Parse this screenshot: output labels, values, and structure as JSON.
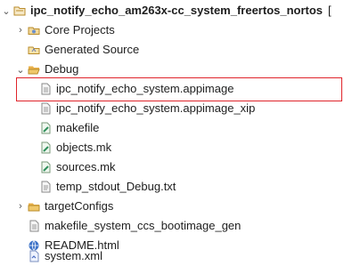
{
  "tree": {
    "project": {
      "label": "ipc_notify_echo_am263x-cc_system_freertos_nortos",
      "suffix": "[",
      "icon": "project-folder-icon",
      "expanded": true
    },
    "items": [
      {
        "label": "Core Projects",
        "icon": "core-projects-icon",
        "expandable": true,
        "expanded": false
      },
      {
        "label": "Generated Source",
        "icon": "generated-source-icon",
        "expandable": false
      },
      {
        "label": "Debug",
        "icon": "folder-open-icon",
        "expandable": true,
        "expanded": true
      },
      {
        "label": "ipc_notify_echo_system.appimage",
        "icon": "file-icon",
        "highlighted": true
      },
      {
        "label": "ipc_notify_echo_system.appimage_xip",
        "icon": "file-icon"
      },
      {
        "label": "makefile",
        "icon": "makefile-icon"
      },
      {
        "label": "objects.mk",
        "icon": "makefile-icon"
      },
      {
        "label": "sources.mk",
        "icon": "makefile-icon"
      },
      {
        "label": "temp_stdout_Debug.txt",
        "icon": "text-file-icon"
      },
      {
        "label": "targetConfigs",
        "icon": "folder-icon",
        "expandable": true,
        "expanded": false
      },
      {
        "label": "makefile_system_ccs_bootimage_gen",
        "icon": "file-icon"
      },
      {
        "label": "README.html",
        "icon": "html-file-icon"
      },
      {
        "label": "system.xml",
        "icon": "xml-file-icon"
      }
    ]
  },
  "colors": {
    "highlight_border": "#e0242b",
    "folder": "#e8b04a",
    "text": "#1e1e1e"
  }
}
